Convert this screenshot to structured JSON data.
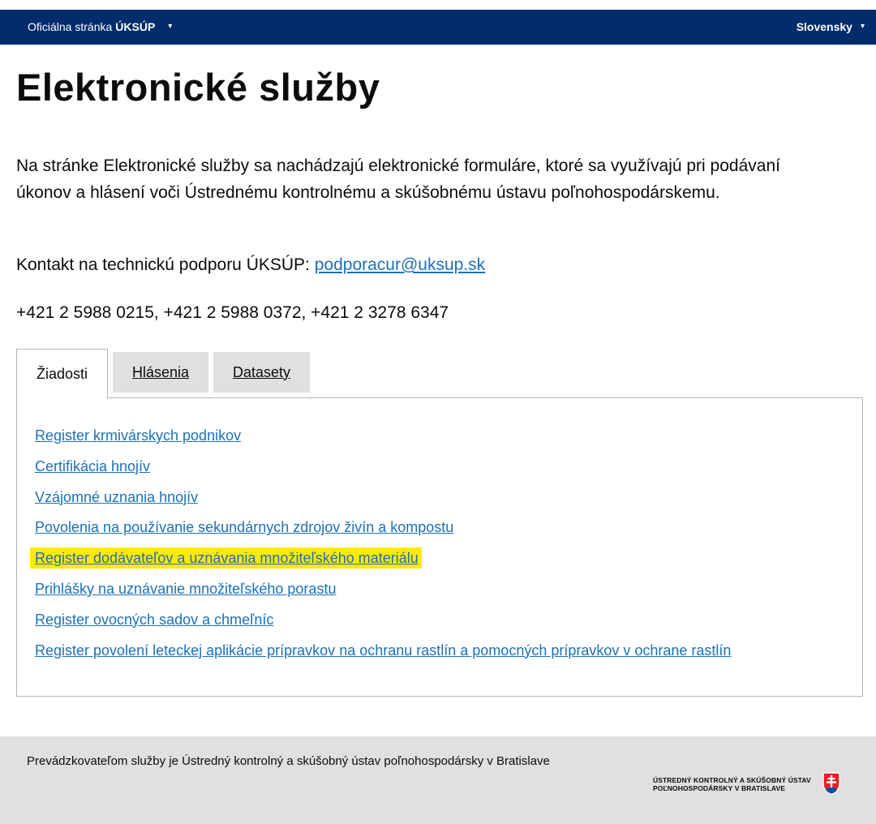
{
  "topbar": {
    "official_prefix": "Oficiálna stránka",
    "official_org": "ÚKSÚP",
    "language": "Slovensky"
  },
  "page": {
    "title": "Elektronické služby",
    "intro": "Na stránke Elektronické služby sa nachádzajú elektronické formuláre, ktoré sa využívajú pri podávaní úkonov a hlásení voči Ústrednému kontrolnému a skúšobnému ústavu poľnohospodárskemu.",
    "contact_label": "Kontakt na technickú podporu ÚKSÚP:",
    "contact_email": "podporacur@uksup.sk",
    "phones": "+421 2 5988 0215, +421 2 5988 0372, +421 2 3278 6347"
  },
  "tabs": [
    {
      "label": "Žiadosti",
      "active": true
    },
    {
      "label": "Hlásenia",
      "active": false
    },
    {
      "label": "Datasety",
      "active": false
    }
  ],
  "links": [
    "Register krmivárskych podnikov",
    "Certifikácia hnojív",
    "Vzájomné uznania hnojív",
    "Povolenia na používanie sekundárnych zdrojov živín a kompostu",
    "Register dodávateľov a uznávania množiteľského materiálu",
    "Prihlášky na uznávanie množiteľského porastu",
    "Register ovocných sadov a chmeľníc",
    "Register povolení leteckej aplikácie prípravkov na ochranu rastlín a pomocných prípravkov v ochrane rastlín"
  ],
  "highlighted_link_index": 4,
  "footer": {
    "operator": "Prevádzkovateľom služby je Ústredný kontrolný a skúšobný ústav poľnohospodársky v Bratislave",
    "logo_line1": "ÚSTREDNÝ KONTROLNÝ A SKÚŠOBNÝ ÚSTAV",
    "logo_line2": "POĽNOHOSPODÁRSKY V BRATISLAVE"
  },
  "colors": {
    "topbar_bg": "#002c6c",
    "link": "#1d70b8",
    "highlight": "#ffeb00",
    "footer_bg": "#dee0e2",
    "tab_inactive_bg": "#dee0e2"
  },
  "icons": {
    "official_dropdown": "chevron-down-icon",
    "language_dropdown": "chevron-down-icon",
    "crest": "slovak-coat-of-arms-icon"
  }
}
